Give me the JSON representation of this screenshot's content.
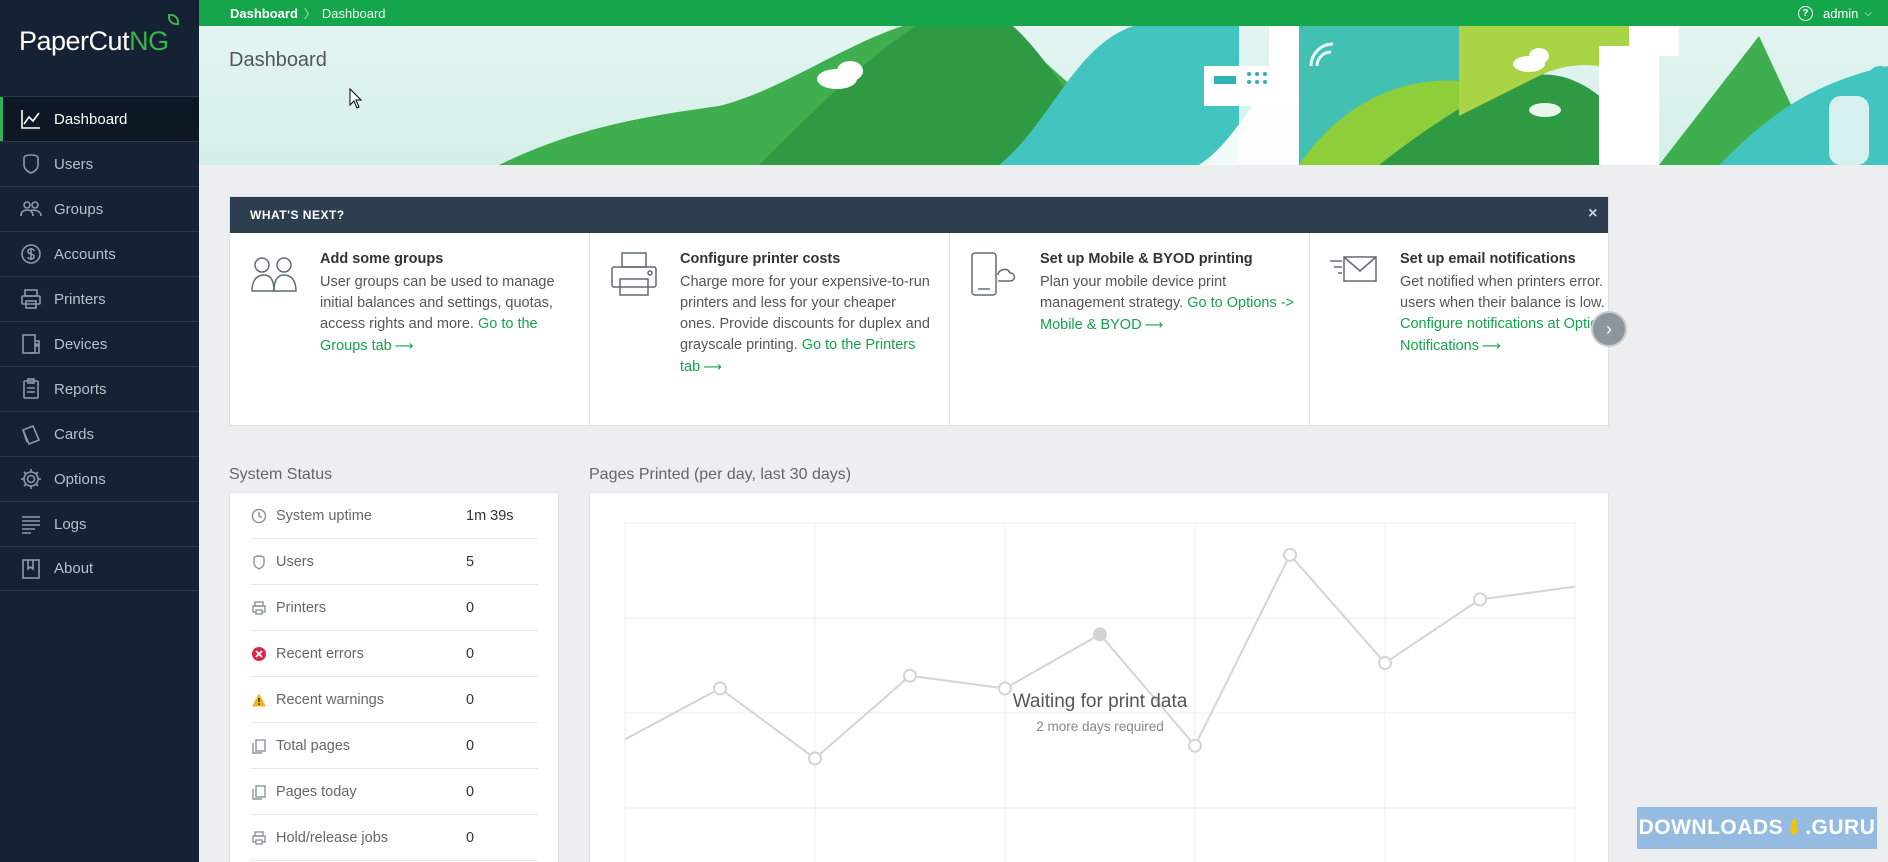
{
  "app": {
    "logo_main": "PaperCut",
    "logo_suffix": "NG"
  },
  "sidebar": {
    "items": [
      {
        "label": "Dashboard",
        "icon": "chart-line-icon",
        "active": true
      },
      {
        "label": "Users",
        "icon": "user-shield-icon"
      },
      {
        "label": "Groups",
        "icon": "groups-icon"
      },
      {
        "label": "Accounts",
        "icon": "accounts-icon"
      },
      {
        "label": "Printers",
        "icon": "printer-icon"
      },
      {
        "label": "Devices",
        "icon": "device-icon"
      },
      {
        "label": "Reports",
        "icon": "clipboard-icon"
      },
      {
        "label": "Cards",
        "icon": "cards-icon"
      },
      {
        "label": "Options",
        "icon": "gear-icon"
      },
      {
        "label": "Logs",
        "icon": "logs-icon"
      },
      {
        "label": "About",
        "icon": "book-icon"
      }
    ]
  },
  "topbar": {
    "breadcrumb": [
      "Dashboard",
      "Dashboard"
    ],
    "user": "admin",
    "help_glyph": "?",
    "chevron": "⌵"
  },
  "page": {
    "title": "Dashboard"
  },
  "whats_next": {
    "header": "WHAT'S NEXT?",
    "close_glyph": "×",
    "next_glyph": "›",
    "cards": [
      {
        "title": "Add some groups",
        "body": "User groups can be used to manage initial balances and settings, quotas, access rights and more. ",
        "link": "Go to the Groups tab",
        "icon": "groups-icon"
      },
      {
        "title": "Configure printer costs",
        "body": "Charge more for your expensive-to-run printers and less for your cheaper ones. Provide discounts for duplex and grayscale printing. ",
        "link": "Go to the Printers tab",
        "icon": "printer-icon"
      },
      {
        "title": "Set up Mobile & BYOD printing",
        "body": "Plan your mobile device print management strategy. ",
        "link": "Go to Options -> Mobile & BYOD",
        "icon": "mobile-cloud-icon"
      },
      {
        "title": "Set up email notifications",
        "body": "Get notified when printers error. E users when their balance is low. ",
        "link": "Configure notifications at Optic Notifications",
        "icon": "email-icon"
      }
    ],
    "arrow_glyph": "⟶"
  },
  "system_status": {
    "title": "System Status",
    "rows": [
      {
        "label": "System uptime",
        "value": "1m 39s",
        "icon": "clock-icon"
      },
      {
        "label": "Users",
        "value": "5",
        "icon": "user-shield-icon"
      },
      {
        "label": "Printers",
        "value": "0",
        "icon": "printer-icon"
      },
      {
        "label": "Recent errors",
        "value": "0",
        "icon": "error-icon"
      },
      {
        "label": "Recent warnings",
        "value": "0",
        "icon": "warning-icon"
      },
      {
        "label": "Total pages",
        "value": "0",
        "icon": "pages-icon"
      },
      {
        "label": "Pages today",
        "value": "0",
        "icon": "pages-icon"
      },
      {
        "label": "Hold/release jobs",
        "value": "0",
        "icon": "printer-icon"
      }
    ]
  },
  "pages_printed": {
    "title": "Pages Printed (per day, last 30 days)",
    "message": "Waiting for print data",
    "submessage": "2 more days required"
  },
  "chart_data": {
    "type": "line",
    "title": "Pages Printed (per day, last 30 days)",
    "x": [
      0,
      1,
      2,
      3,
      4,
      5,
      6,
      7,
      8,
      9,
      10
    ],
    "values": [
      42,
      58,
      36,
      62,
      58,
      75,
      40,
      100,
      66,
      86,
      90
    ],
    "ylim": [
      0,
      110
    ],
    "grid": true,
    "placeholder": true
  },
  "watermark": {
    "text": "DOWNLOADS",
    "suffix": ".GURU"
  },
  "colors": {
    "brand_green": "#15a54a",
    "sidebar_bg": "#152233",
    "link_green": "#16a24b",
    "panel_header": "#2c3e50"
  }
}
